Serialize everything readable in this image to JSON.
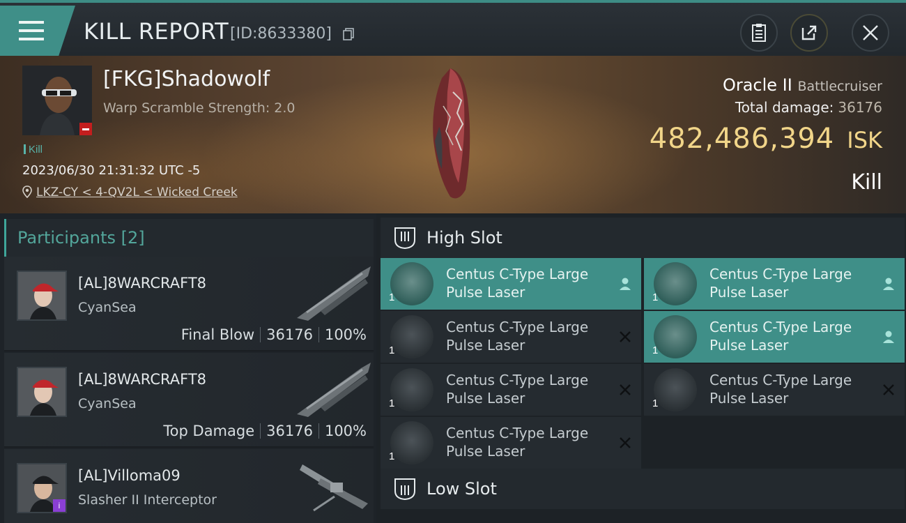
{
  "header": {
    "title": "KILL REPORT",
    "report_id": "[ID:8633380]"
  },
  "victim": {
    "name": "[FKG]Shadowolf",
    "subtitle": "Warp Scramble Strength: 2.0",
    "tag": "Kill",
    "datetime": "2023/06/30 21:31:32 UTC -5",
    "location": "LKZ-CY < 4-QV2L < Wicked Creek"
  },
  "ship": {
    "name": "Oracle II",
    "class": "Battlecruiser",
    "total_damage_label": "Total damage:",
    "total_damage": "36176",
    "value": "482,486,394",
    "currency": "ISK",
    "result": "Kill"
  },
  "participants": {
    "label": "Participants",
    "count": "[2]",
    "rows": [
      {
        "name": "[AL]8WARCRAFT8",
        "corp": "CyanSea",
        "role": "Final Blow",
        "damage": "36176",
        "percent": "100%"
      },
      {
        "name": "[AL]8WARCRAFT8",
        "corp": "CyanSea",
        "role": "Top Damage",
        "damage": "36176",
        "percent": "100%"
      },
      {
        "name": "[AL]Villoma09",
        "corp": "Slasher II Interceptor"
      }
    ]
  },
  "high_slot": {
    "label": "High Slot",
    "modules": [
      {
        "name_line1": "Centus C-Type Large",
        "name_line2": "Pulse Laser",
        "qty": "1",
        "status": "dropped"
      },
      {
        "name_line1": "Centus C-Type Large",
        "name_line2": "Pulse Laser",
        "qty": "1",
        "status": "dropped"
      },
      {
        "name_line1": "Centus C-Type Large",
        "name_line2": "Pulse Laser",
        "qty": "1",
        "status": "destroyed"
      },
      {
        "name_line1": "Centus C-Type Large",
        "name_line2": "Pulse Laser",
        "qty": "1",
        "status": "dropped"
      },
      {
        "name_line1": "Centus C-Type Large",
        "name_line2": "Pulse Laser",
        "qty": "1",
        "status": "destroyed"
      },
      {
        "name_line1": "Centus C-Type Large",
        "name_line2": "Pulse Laser",
        "qty": "1",
        "status": "destroyed"
      },
      {
        "name_line1": "Centus C-Type Large",
        "name_line2": "Pulse Laser",
        "qty": "1",
        "status": "destroyed"
      }
    ]
  },
  "low_slot": {
    "label": "Low Slot"
  },
  "colors": {
    "accent": "#3f8f88",
    "isk_gold": "#f1d589",
    "corp_red": "#c41e1e",
    "badge_purple": "#8a3fd4"
  },
  "icons": [
    "menu-icon",
    "copy-icon",
    "clipboard-icon",
    "share-icon",
    "close-icon",
    "location-pin-icon",
    "high-slot-icon",
    "low-slot-icon",
    "person-icon",
    "x-icon"
  ]
}
